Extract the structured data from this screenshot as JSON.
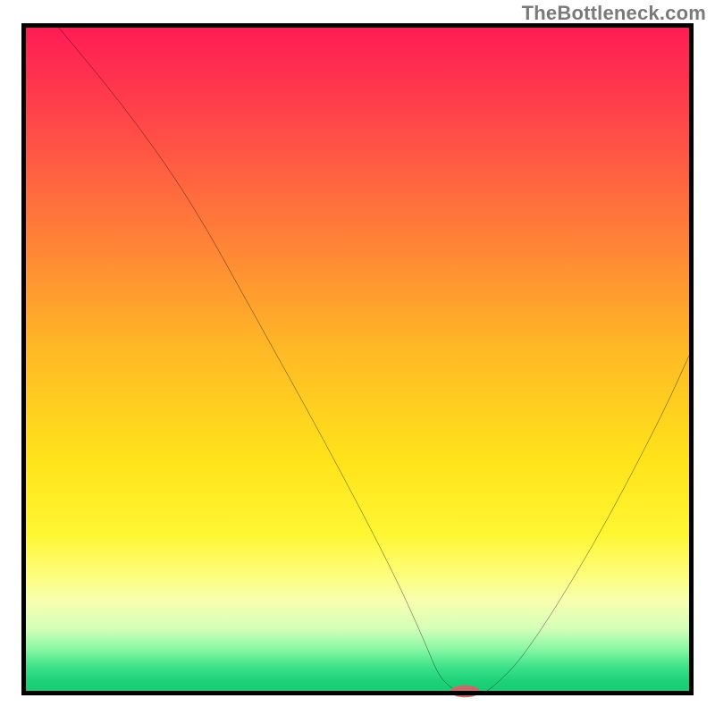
{
  "watermark": "TheBottleneck.com",
  "chart_data": {
    "type": "line",
    "title": "",
    "xlabel": "",
    "ylabel": "",
    "xlim": [
      0,
      100
    ],
    "ylim": [
      0,
      100
    ],
    "background": "gradient-red-to-green",
    "series": [
      {
        "name": "bottleneck-curve",
        "x": [
          5,
          15,
          25,
          35,
          45,
          55,
          60,
          62,
          64,
          66,
          68,
          70,
          75,
          85,
          95,
          100
        ],
        "values": [
          100,
          88,
          74,
          56,
          38,
          19,
          8,
          3,
          1,
          0,
          0,
          1,
          6,
          22,
          41,
          52
        ]
      }
    ],
    "marker": {
      "name": "optimal-region",
      "x": 66,
      "y": 0.6,
      "rx": 2.2,
      "ry": 0.9,
      "color": "#c96a69"
    }
  }
}
